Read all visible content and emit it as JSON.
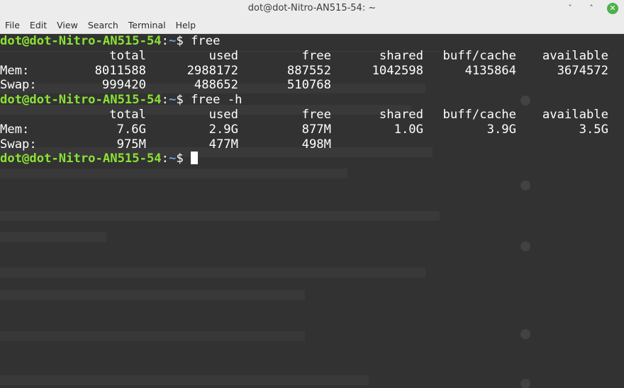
{
  "window": {
    "title": "dot@dot-Nitro-AN515-54: ~",
    "minimize_glyph": "ˇ",
    "maximize_glyph": "˄",
    "close_glyph": "✕"
  },
  "menu": [
    "File",
    "Edit",
    "View",
    "Search",
    "Terminal",
    "Help"
  ],
  "prompt": {
    "user_host": "dot@dot-Nitro-AN515-54",
    "colon": ":",
    "path": "~",
    "dollar": "$ "
  },
  "commands": [
    "free",
    "free -h"
  ],
  "free_table": {
    "headers": [
      "total",
      "used",
      "free",
      "shared",
      "buff/cache",
      "available"
    ],
    "rows": [
      {
        "label": "Mem:",
        "values": [
          "8011588",
          "2988172",
          "887552",
          "1042598",
          "4135864",
          "3674572"
        ]
      },
      {
        "label": "Swap:",
        "values": [
          "999420",
          "488652",
          "510768",
          "",
          "",
          ""
        ]
      }
    ]
  },
  "free_h_table": {
    "headers": [
      "total",
      "used",
      "free",
      "shared",
      "buff/cache",
      "available"
    ],
    "rows": [
      {
        "label": "Mem:",
        "values": [
          "7.6G",
          "2.9G",
          "877M",
          "1.0G",
          "3.9G",
          "3.5G"
        ]
      },
      {
        "label": "Swap:",
        "values": [
          "975M",
          "477M",
          "498M",
          "",
          "",
          ""
        ]
      }
    ]
  },
  "colors": {
    "prompt_user": "#8ae234",
    "prompt_path": "#729fcf",
    "terminal_bg": "#323232",
    "close_button": "#4eb04a"
  }
}
